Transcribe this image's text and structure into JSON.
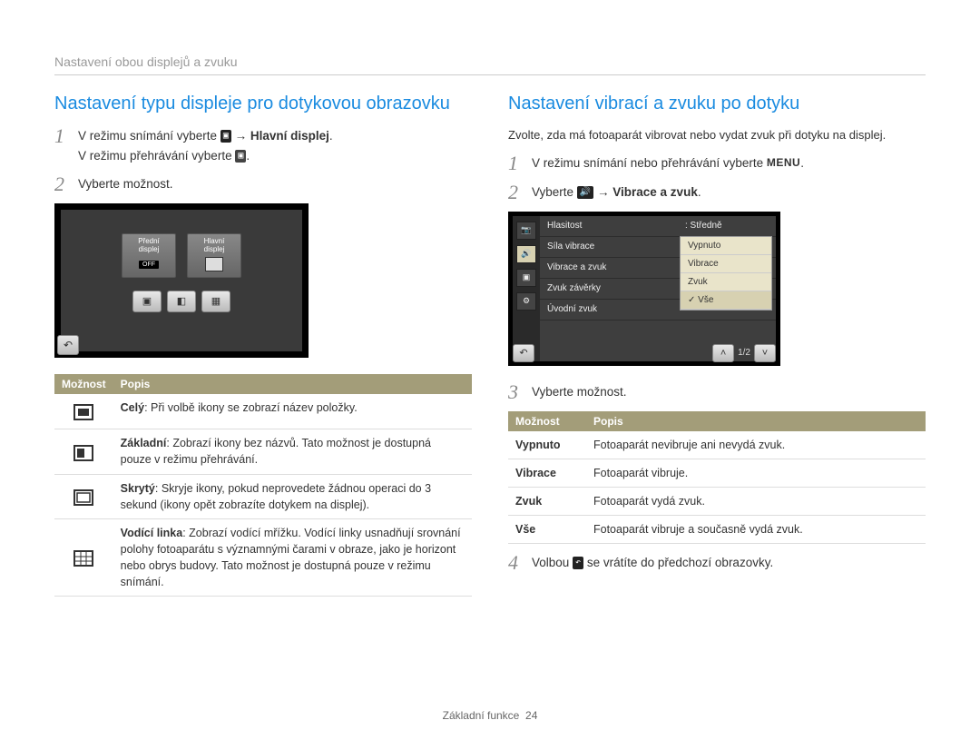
{
  "breadcrumb": "Nastavení obou displejů a zvuku",
  "left": {
    "title": "Nastavení typu displeje pro dotykovou obrazovku",
    "step1_a": "V režimu snímání vyberte ",
    "step1_b": " Hlavní displej",
    "step1_c": "V režimu přehrávání vyberte ",
    "step2": "Vyberte možnost.",
    "mock": {
      "front_display_line1": "Přední",
      "front_display_line2": "displej",
      "front_display_off": "OFF",
      "main_display_line1": "Hlavní",
      "main_display_line2": "displej"
    },
    "table_header_option": "Možnost",
    "table_header_desc": "Popis",
    "rows": [
      {
        "bold": "Celý",
        "desc": ": Při volbě ikony se zobrazí název položky."
      },
      {
        "bold": "Základní",
        "desc": ": Zobrazí ikony bez názvů. Tato možnost je dostupná pouze v režimu přehrávání."
      },
      {
        "bold": "Skrytý",
        "desc": ": Skryje ikony, pokud neprovedete žádnou operaci do 3 sekund (ikony opět zobrazíte dotykem na displej)."
      },
      {
        "bold": "Vodící linka",
        "desc": ": Zobrazí vodící mřížku. Vodící linky usnadňují srovnání polohy fotoaparátu s významnými čarami v obraze, jako je horizont nebo obrys budovy. Tato možnost je dostupná pouze v režimu snímání."
      }
    ]
  },
  "right": {
    "title": "Nastavení vibrací a zvuku po dotyku",
    "intro": "Zvolte, zda má fotoaparát vibrovat nebo vydat zvuk při dotyku na displej.",
    "step1": "V režimu snímání nebo přehrávání vyberte ",
    "step2_a": "Vyberte ",
    "step2_b": " Vibrace a zvuk",
    "mock": {
      "items": [
        {
          "label": "Hlasitost",
          "value": ": Středně"
        },
        {
          "label": "Síla vibrace",
          "value": ""
        },
        {
          "label": "Vibrace a zvuk",
          "value": ""
        },
        {
          "label": "Zvuk závěrky",
          "value": ""
        },
        {
          "label": "Úvodní zvuk",
          "value": ""
        }
      ],
      "popup": [
        "Vypnuto",
        "Vibrace",
        "Zvuk",
        "✓ Vše"
      ],
      "page": "1/2"
    },
    "step3": "Vyberte možnost.",
    "table_header_option": "Možnost",
    "table_header_desc": "Popis",
    "rows": [
      {
        "name": "Vypnuto",
        "desc": "Fotoaparát nevibruje ani nevydá zvuk."
      },
      {
        "name": "Vibrace",
        "desc": "Fotoaparát vibruje."
      },
      {
        "name": "Zvuk",
        "desc": "Fotoaparát vydá zvuk."
      },
      {
        "name": "Vše",
        "desc": "Fotoaparát vibruje a současně vydá zvuk."
      }
    ],
    "step4_a": "Volbou ",
    "step4_b": " se vrátíte do předchozí obrazovky."
  },
  "footer_label": "Základní funkce",
  "footer_page": "24"
}
